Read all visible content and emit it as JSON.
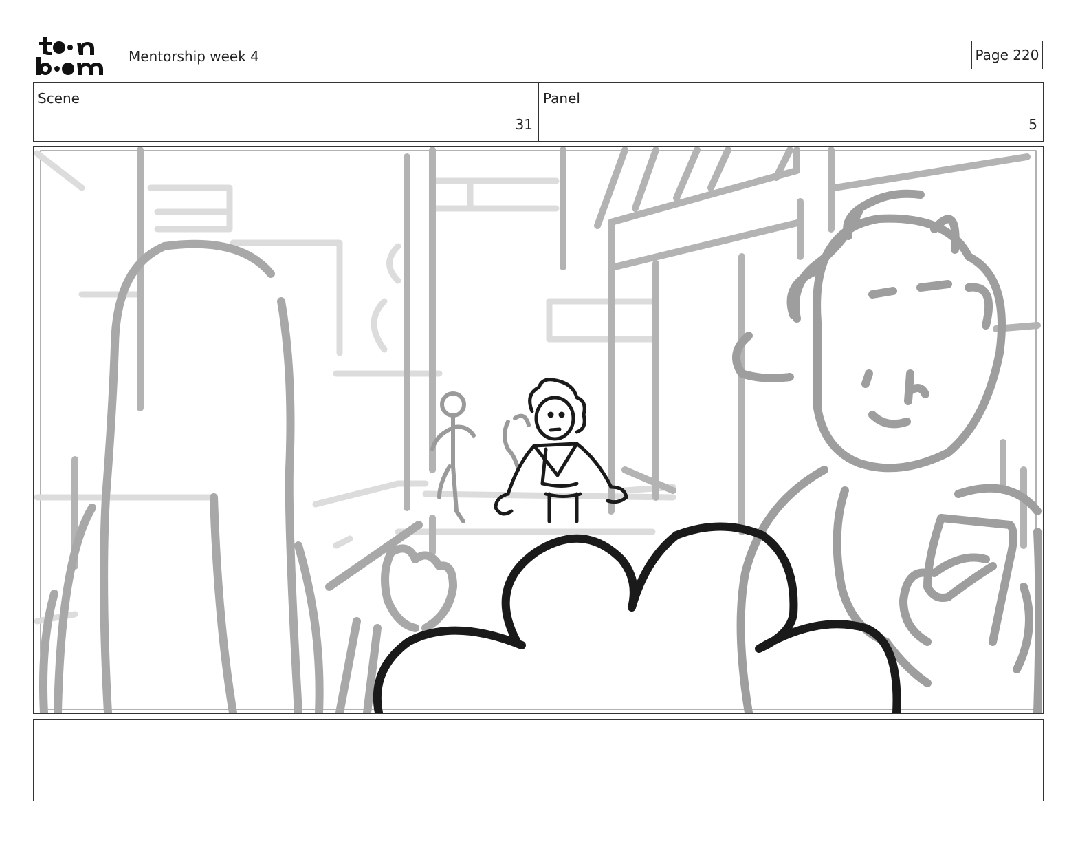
{
  "header": {
    "brand": "toon boom",
    "document_title": "Mentorship week 4",
    "page_label": "Page 220"
  },
  "info": {
    "scene_label": "Scene",
    "scene_value": "31",
    "panel_label": "Panel",
    "panel_value": "5"
  },
  "notes": {
    "text": ""
  },
  "colors": {
    "border": "#333333",
    "sketch_light": "#d8d8d8",
    "sketch_mid": "#a6a6a6",
    "ink": "#1a1a1a"
  }
}
